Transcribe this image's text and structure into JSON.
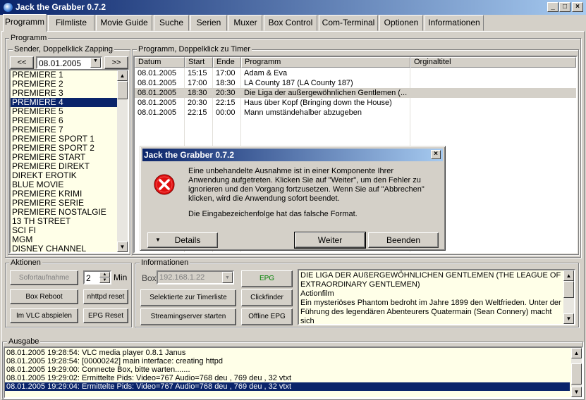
{
  "window": {
    "title": "Jack the Grabber 0.7.2",
    "minimize": "_",
    "maximize": "□",
    "close": "×"
  },
  "tabs": [
    "Programm",
    "Filmliste",
    "Movie Guide",
    "Suche",
    "Serien",
    "Muxer",
    "Box Control",
    "Com-Terminal",
    "Optionen",
    "Informationen"
  ],
  "programm": {
    "label": "Programm",
    "sender": {
      "label": "Sender, Doppelklick Zapping",
      "prev": "<<",
      "next": ">>",
      "date": "08.01.2005",
      "items": [
        "PREMIERE 1",
        "PREMIERE 2",
        "PREMIERE 3",
        "PREMIERE 4",
        "PREMIERE 5",
        "PREMIERE 6",
        "PREMIERE 7",
        "PREMIERE SPORT 1",
        "PREMIERE SPORT 2",
        "PREMIERE START",
        "PREMIERE DIREKT",
        "DIREKT EROTIK",
        "BLUE MOVIE",
        "PREMIERE KRIMI",
        "PREMIERE SERIE",
        "PREMIERE NOSTALGIE",
        "13 TH STREET",
        "SCI FI",
        "MGM",
        "DISNEY CHANNEL"
      ],
      "selected_index": 3
    },
    "schedule": {
      "label": "Programm, Doppelklick zu Timer",
      "headers": [
        "Datum",
        "Start",
        "Ende",
        "Programm",
        "Orginaltitel"
      ],
      "rows": [
        [
          "08.01.2005",
          "15:15",
          "17:00",
          "Adam & Eva",
          ""
        ],
        [
          "08.01.2005",
          "17:00",
          "18:30",
          "LA County 187 (LA County 187)",
          ""
        ],
        [
          "08.01.2005",
          "18:30",
          "20:30",
          "Die Liga der außergewöhnlichen Gentlemen (...",
          ""
        ],
        [
          "08.01.2005",
          "20:30",
          "22:15",
          "Haus über Kopf (Bringing down the House)",
          ""
        ],
        [
          "08.01.2005",
          "22:15",
          "00:00",
          "Mann umständehalber abzugeben",
          ""
        ]
      ],
      "selected_index": 2
    }
  },
  "aktionen": {
    "label": "Aktionen",
    "sofortaufnahme": "Sofortaufnahme",
    "minutes": "2",
    "min_label": "Min",
    "box_reboot": "Box Reboot",
    "nhttpd_reset": "nhttpd reset",
    "vlc": "Im VLC abspielen",
    "epg_reset": "EPG Reset"
  },
  "informationen": {
    "label": "Informationen",
    "box_label": "Box",
    "box_ip": "192.168.1.22",
    "epg": "EPG",
    "timerliste": "Selektierte zur Timerliste",
    "clickfinder": "Clickfinder",
    "streaming": "Streamingserver starten",
    "offline_epg": "Offline EPG",
    "desc_title": "DIE LIGA DER AUßERGEWÖHNLICHEN GENTLEMEN (THE LEAGUE OF EXTRAORDINARY GENTLEMEN)",
    "desc_genre": "Actionfilm",
    "desc_text": "Ein mysteriöses Phantom bedroht im Jahre 1899 den Weltfrieden. Unter der Führung des legendären Abenteurers Quatermain (Sean Connery) macht sich"
  },
  "ausgabe": {
    "label": "Ausgabe",
    "lines": [
      "08.01.2005 19:28:54: VLC media player 0.8.1 Janus",
      "08.01.2005 19:28:54: [00000242] main interface: creating httpd",
      "08.01.2005 19:29:00: Connecte Box, bitte warten.......",
      "08.01.2005 19:29:02: Ermittelte Pids: Video=767 Audio=768 deu  , 769 deu  , 32 vtxt",
      "08.01.2005 19:29:04: Ermittelte Pids: Video=767 Audio=768 deu  , 769 deu  , 32 vtxt"
    ],
    "selected_index": 4
  },
  "dialog": {
    "title": "Jack the Grabber 0.7.2",
    "message": "Eine unbehandelte Ausnahme ist in einer Komponente Ihrer Anwendung aufgetreten. Klicken Sie auf \"Weiter\", um den Fehler zu ignorieren und den Vorgang fortzusetzen. Wenn Sie auf \"Abbrechen\" klicken, wird die Anwendung sofort beendet.",
    "error": "Die Eingabezeichenfolge hat das falsche Format.",
    "details": "Details",
    "weiter": "Weiter",
    "beenden": "Beenden"
  }
}
